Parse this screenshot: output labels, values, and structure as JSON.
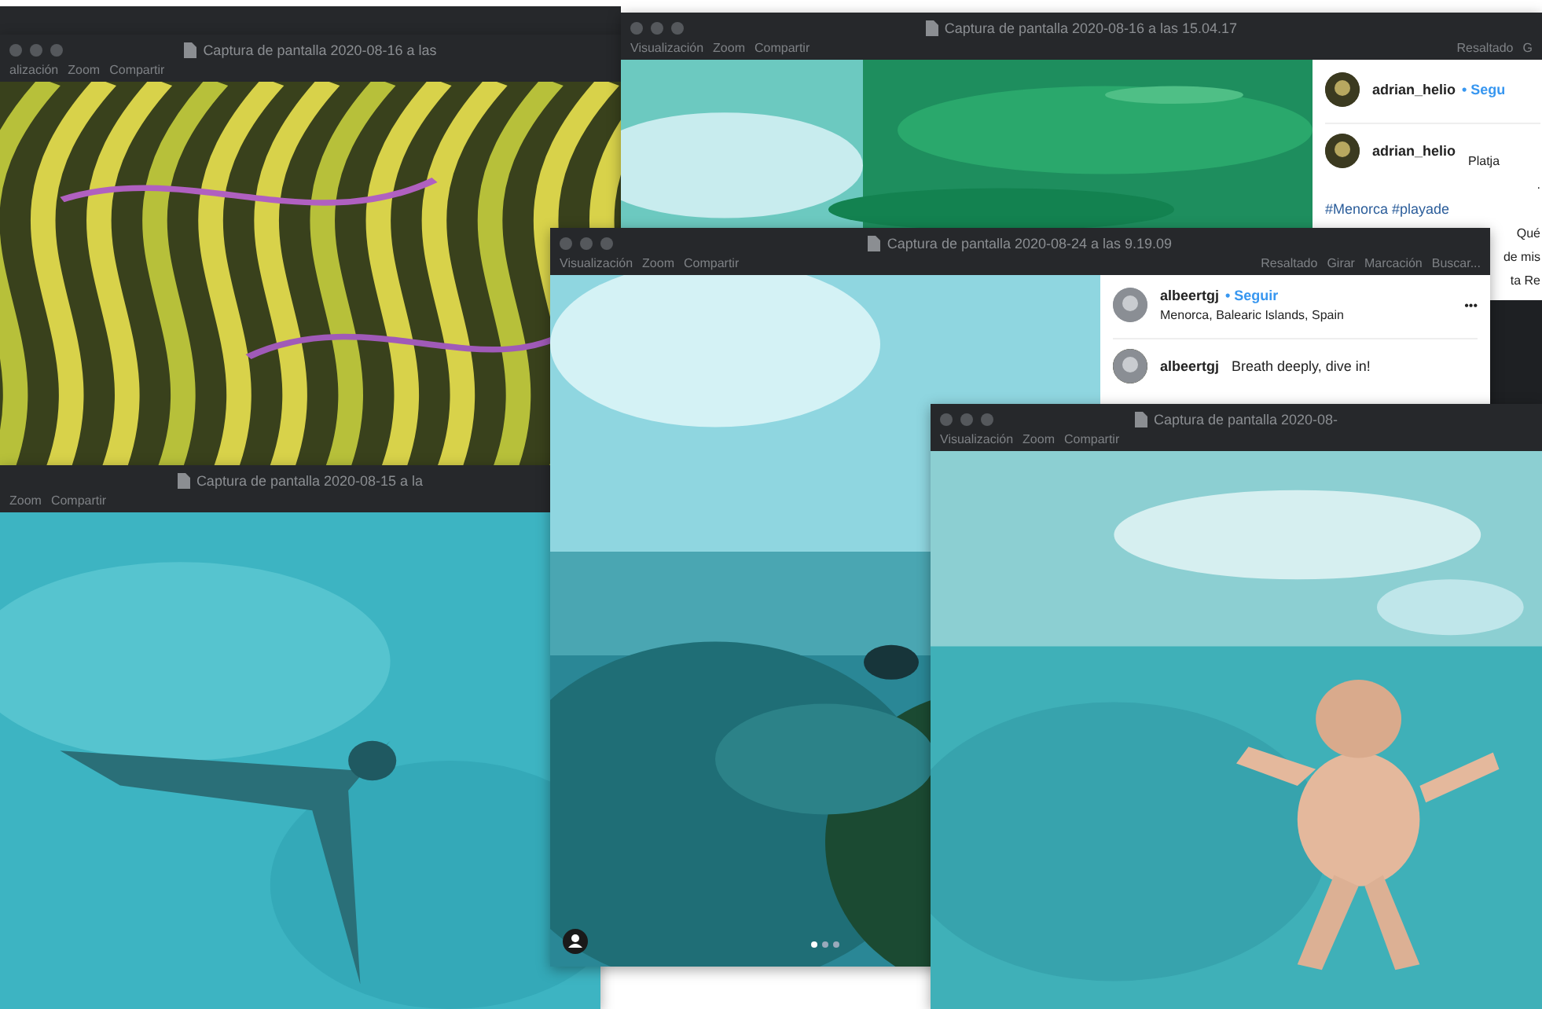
{
  "windows": [
    {
      "title": "Captura de pantalla 2020-08-16 a las",
      "menu": [
        "alización",
        "Zoom",
        "Compartir"
      ]
    },
    {
      "title": "Captura de pantalla 2020-08-16 a las 15.04.17",
      "menu": [
        "Visualización",
        "Zoom",
        "Compartir"
      ],
      "tools": [
        "Resaltado",
        "G"
      ],
      "sidebar": [
        {
          "kind": "header",
          "user": "adrian_helio",
          "follow": "• Segu"
        },
        {
          "kind": "comment",
          "user": "adrian_helio",
          "text": "Platja"
        },
        {
          "kind": "line",
          "text": "."
        },
        {
          "kind": "tags",
          "text": "#Menorca #playade"
        },
        {
          "kind": "line",
          "text": "Qué"
        },
        {
          "kind": "line",
          "text": "de mis"
        },
        {
          "kind": "line",
          "text": "ta  Re"
        }
      ]
    },
    {
      "title": "Captura de pantalla 2020-08-15 a la",
      "menu": [
        "Zoom",
        "Compartir"
      ]
    },
    {
      "title": "Captura de pantalla 2020-08-24 a las 9.19.09",
      "menu": [
        "Visualización",
        "Zoom",
        "Compartir"
      ],
      "tools": [
        "Resaltado",
        "Girar",
        "Marcación",
        "Buscar..."
      ],
      "sidebar": [
        {
          "kind": "header",
          "user": "albeertgj",
          "follow": "• Seguir",
          "place": "Menorca, Balearic Islands, Spain",
          "more": "•••"
        },
        {
          "kind": "comment",
          "user": "albeertgj",
          "text": "Breath deeply, dive in!"
        }
      ]
    },
    {
      "title": "Captura de pantalla 2020-08-",
      "menu": [
        "Visualización",
        "Zoom",
        "Compartir"
      ]
    }
  ]
}
